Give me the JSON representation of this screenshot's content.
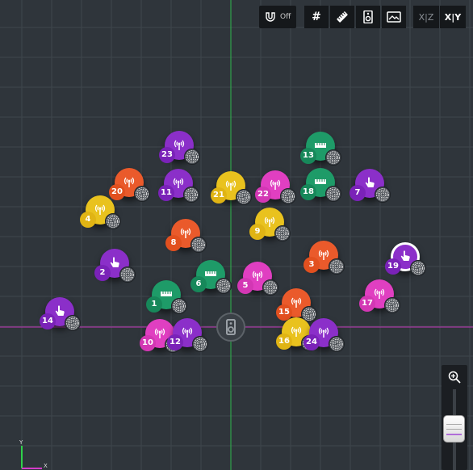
{
  "toolbar": {
    "snap_label": "Off",
    "view_xz_label": "X|Z",
    "view_xy_label": "X|Y"
  },
  "axes": {
    "y_label": "Y",
    "x_label": "X"
  },
  "colors": {
    "purple": "#8b2fc9",
    "orange": "#ea5a2b",
    "green": "#1e9b68",
    "yellow": "#e9c21e",
    "pink": "#e03fc1",
    "selected_ring": "#ffffff"
  },
  "nodes": [
    {
      "num": "1",
      "color": "green",
      "icon": "ruler-icon"
    },
    {
      "num": "2",
      "color": "purple",
      "icon": "hand-pointer-icon"
    },
    {
      "num": "3",
      "color": "orange",
      "icon": "antenna-icon"
    },
    {
      "num": "4",
      "color": "yellow",
      "icon": "antenna-icon"
    },
    {
      "num": "5",
      "color": "pink",
      "icon": "antenna-icon"
    },
    {
      "num": "6",
      "color": "green",
      "icon": "ruler-icon"
    },
    {
      "num": "7",
      "color": "purple",
      "icon": "hand-pointer-icon"
    },
    {
      "num": "8",
      "color": "orange",
      "icon": "antenna-icon"
    },
    {
      "num": "9",
      "color": "yellow",
      "icon": "antenna-icon"
    },
    {
      "num": "10",
      "color": "pink",
      "icon": "antenna-icon"
    },
    {
      "num": "11",
      "color": "purple",
      "icon": "antenna-icon"
    },
    {
      "num": "12",
      "color": "purple",
      "icon": "antenna-icon"
    },
    {
      "num": "13",
      "color": "green",
      "icon": "ruler-icon"
    },
    {
      "num": "14",
      "color": "purple",
      "icon": "hand-pointer-icon"
    },
    {
      "num": "15",
      "color": "orange",
      "icon": "antenna-icon"
    },
    {
      "num": "16",
      "color": "yellow",
      "icon": "antenna-icon"
    },
    {
      "num": "17",
      "color": "pink",
      "icon": "antenna-icon"
    },
    {
      "num": "18",
      "color": "green",
      "icon": "ruler-icon"
    },
    {
      "num": "19",
      "color": "purple",
      "icon": "hand-pointer-icon",
      "selected": true
    },
    {
      "num": "20",
      "color": "orange",
      "icon": "antenna-icon"
    },
    {
      "num": "21",
      "color": "yellow",
      "icon": "antenna-icon"
    },
    {
      "num": "22",
      "color": "pink",
      "icon": "antenna-icon"
    },
    {
      "num": "23",
      "color": "purple",
      "icon": "antenna-icon"
    },
    {
      "num": "24",
      "color": "purple",
      "icon": "antenna-icon"
    }
  ]
}
